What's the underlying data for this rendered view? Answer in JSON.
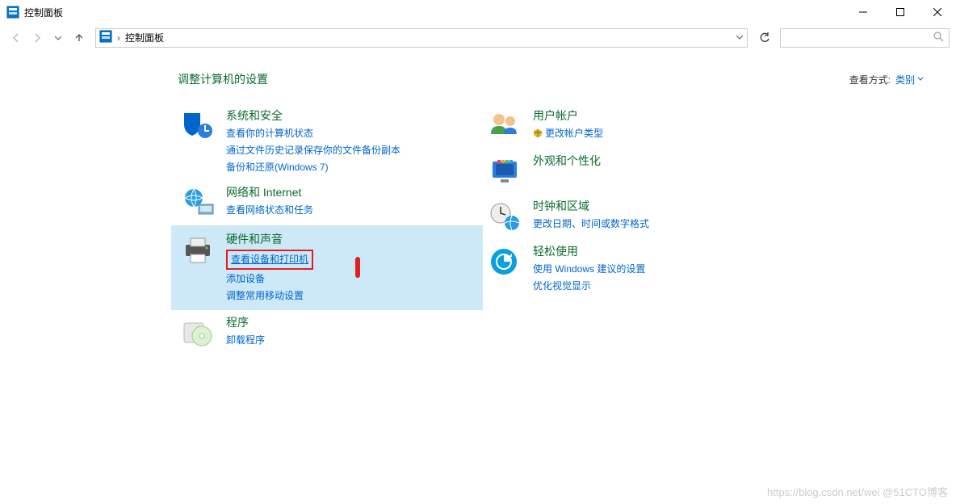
{
  "titlebar": {
    "title": "控制面板"
  },
  "addressbar": {
    "crumb": "控制面板"
  },
  "header": {
    "page_title": "调整计算机的设置",
    "view_by_label": "查看方式:",
    "view_by_mode": "类别"
  },
  "left_col": {
    "system": {
      "title": "系统和安全",
      "links": [
        "查看你的计算机状态",
        "通过文件历史记录保存你的文件备份副本",
        "备份和还原(Windows 7)"
      ]
    },
    "network": {
      "title": "网络和 Internet",
      "links": [
        "查看网络状态和任务"
      ]
    },
    "hardware": {
      "title": "硬件和声音",
      "links": [
        "查看设备和打印机",
        "添加设备",
        "调整常用移动设置"
      ]
    },
    "programs": {
      "title": "程序",
      "links": [
        "卸载程序"
      ]
    }
  },
  "right_col": {
    "users": {
      "title": "用户帐户",
      "links": [
        "更改帐户类型"
      ]
    },
    "appearance": {
      "title": "外观和个性化"
    },
    "clock": {
      "title": "时钟和区域",
      "links": [
        "更改日期、时间或数字格式"
      ]
    },
    "ease": {
      "title": "轻松使用",
      "links": [
        "使用 Windows 建议的设置",
        "优化视觉显示"
      ]
    }
  },
  "watermark": "https://blog.csdn.net/wei @51CTO博客"
}
